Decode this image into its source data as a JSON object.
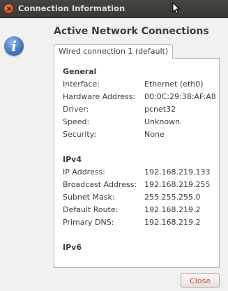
{
  "window": {
    "title": "Connection Information"
  },
  "header": {
    "heading": "Active Network Connections",
    "icon": "info-icon"
  },
  "tabs": [
    {
      "label": "Wired connection 1 (default)",
      "selected": true
    }
  ],
  "sections": {
    "general": {
      "title": "General",
      "rows": [
        {
          "label": "Interface:",
          "value": "Ethernet (eth0)"
        },
        {
          "label": "Hardware Address:",
          "value": "00:0C:29:38:AF:A8"
        },
        {
          "label": "Driver:",
          "value": "pcnet32"
        },
        {
          "label": "Speed:",
          "value": "Unknown"
        },
        {
          "label": "Security:",
          "value": "None"
        }
      ]
    },
    "ipv4": {
      "title": "IPv4",
      "rows": [
        {
          "label": "IP Address:",
          "value": "192.168.219.133"
        },
        {
          "label": "Broadcast Address:",
          "value": "192.168.219.255"
        },
        {
          "label": "Subnet Mask:",
          "value": "255.255.255.0"
        },
        {
          "label": "Default Route:",
          "value": "192.168.219.2"
        },
        {
          "label": "Primary DNS:",
          "value": "192.168.219.2"
        }
      ]
    },
    "ipv6": {
      "title": "IPv6"
    }
  },
  "footer": {
    "close_label": "Close"
  },
  "colors": {
    "titlebar": "#3c3b37",
    "close_button_text": "#d5501e",
    "info_icon": "#3f75c0"
  }
}
